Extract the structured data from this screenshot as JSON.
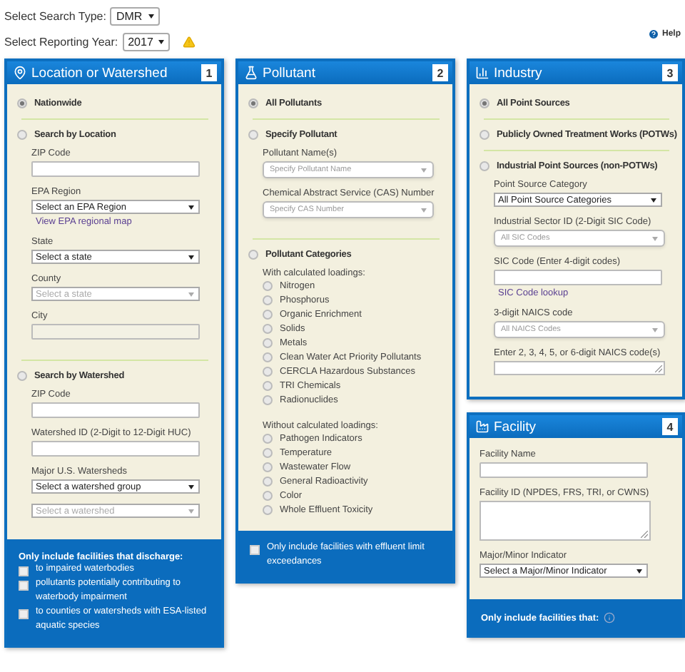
{
  "search_type": {
    "label": "Select Search Type:",
    "value": "DMR"
  },
  "reporting_year": {
    "label": "Select Reporting Year:",
    "value": "2017",
    "warning": true
  },
  "help": "Help",
  "columns": [
    {
      "panels": [
        {
          "number": "1",
          "title": "Location or Watershed",
          "sections": [
            {
              "label": "Nationwide",
              "selected": true
            },
            {
              "label": "Search by Location",
              "selected": false,
              "fields": [
                {
                  "kind": "input",
                  "label": "ZIP Code",
                  "disabled": false
                },
                {
                  "kind": "select",
                  "label": "EPA Region",
                  "value": "Select an EPA Region",
                  "disabled": false
                },
                {
                  "kind": "link",
                  "text": "View EPA regional map"
                },
                {
                  "kind": "select",
                  "label": "State",
                  "value": "Select a state",
                  "disabled": false
                },
                {
                  "kind": "select",
                  "label": "County",
                  "value": "Select a state",
                  "disabled": true
                },
                {
                  "kind": "input",
                  "label": "City",
                  "disabled": true
                }
              ]
            },
            {
              "label": "Search by Watershed",
              "selected": false,
              "fields": [
                {
                  "kind": "input",
                  "label": "ZIP Code",
                  "disabled": false
                },
                {
                  "kind": "input",
                  "label": "Watershed ID (2-Digit to 12-Digit HUC)",
                  "disabled": false
                },
                {
                  "kind": "select",
                  "label": "Major U.S. Watersheds",
                  "value": "Select a watershed group",
                  "disabled": false
                },
                {
                  "kind": "select",
                  "value": "Select a watershed",
                  "disabled": true
                }
              ]
            }
          ],
          "footer": {
            "heading": "Only include facilities that discharge:",
            "checks": [
              {
                "label": "to impaired waterbodies",
                "checked": false
              },
              {
                "label": "pollutants potentially contributing to waterbody impairment",
                "checked": false
              },
              {
                "label": "to counties or watersheds with ESA-listed aquatic species",
                "checked": false
              }
            ]
          }
        }
      ]
    },
    {
      "panels": [
        {
          "number": "2",
          "title": "Pollutant",
          "sections": [
            {
              "label": "All Pollutants",
              "selected": true
            },
            {
              "label": "Specify Pollutant",
              "selected": false,
              "fields": [
                {
                  "kind": "combo",
                  "label": "Pollutant Name(s)",
                  "placeholder": "Specify Pollutant Name"
                },
                {
                  "kind": "combo",
                  "label": "Chemical Abstract Service (CAS) Number",
                  "placeholder": "Specify CAS Number"
                }
              ]
            },
            {
              "label": "Pollutant Categories",
              "selected": false,
              "fields": [
                {
                  "kind": "subheading",
                  "text": "With calculated loadings:"
                },
                {
                  "kind": "option",
                  "label": "Nitrogen",
                  "selected": false
                },
                {
                  "kind": "option",
                  "label": "Phosphorus",
                  "selected": false
                },
                {
                  "kind": "option",
                  "label": "Organic Enrichment",
                  "selected": false
                },
                {
                  "kind": "option",
                  "label": "Solids",
                  "selected": false
                },
                {
                  "kind": "option",
                  "label": "Metals",
                  "selected": false
                },
                {
                  "kind": "option",
                  "label": "Clean Water Act Priority Pollutants",
                  "selected": false
                },
                {
                  "kind": "option",
                  "label": "CERCLA Hazardous Substances",
                  "selected": false
                },
                {
                  "kind": "option",
                  "label": "TRI Chemicals",
                  "selected": false
                },
                {
                  "kind": "option",
                  "label": "Radionuclides",
                  "selected": false
                },
                {
                  "kind": "subheading",
                  "text": "Without calculated loadings:"
                },
                {
                  "kind": "option",
                  "label": "Pathogen Indicators",
                  "selected": false
                },
                {
                  "kind": "option",
                  "label": "Temperature",
                  "selected": false
                },
                {
                  "kind": "option",
                  "label": "Wastewater Flow",
                  "selected": false
                },
                {
                  "kind": "option",
                  "label": "General Radioactivity",
                  "selected": false
                },
                {
                  "kind": "option",
                  "label": "Color",
                  "selected": false
                },
                {
                  "kind": "option",
                  "label": "Whole Effluent Toxicity",
                  "selected": false
                }
              ]
            }
          ],
          "footer": {
            "checks": [
              {
                "label": "Only include facilities with effluent limit exceedances",
                "checked": false
              }
            ]
          }
        }
      ]
    },
    {
      "panels": [
        {
          "number": "3",
          "title": "Industry",
          "sections": [
            {
              "label": "All Point Sources",
              "selected": true
            },
            {
              "label": "Publicly Owned Treatment Works (POTWs)",
              "selected": false
            },
            {
              "label": "Industrial Point Sources (non-POTWs)",
              "selected": false,
              "fields": [
                {
                  "kind": "select",
                  "label": "Point Source Category",
                  "value": "All Point Source Categories",
                  "disabled": false
                },
                {
                  "kind": "combo",
                  "label": "Industrial Sector ID (2-Digit SIC Code)",
                  "placeholder": "All SIC Codes"
                },
                {
                  "kind": "input",
                  "label": "SIC Code (Enter 4-digit codes)",
                  "disabled": false
                },
                {
                  "kind": "link",
                  "text": "SIC Code lookup"
                },
                {
                  "kind": "combo",
                  "label": "3-digit NAICS code",
                  "placeholder": "All NAICS Codes"
                },
                {
                  "kind": "textarea",
                  "label": "Enter 2, 3, 4, 5, or 6-digit NAICS code(s)",
                  "tall": false
                }
              ]
            }
          ]
        },
        {
          "number": "4",
          "title": "Facility",
          "sections": [
            {
              "fields": [
                {
                  "kind": "input",
                  "label": "Facility Name",
                  "disabled": false
                },
                {
                  "kind": "textarea",
                  "label": "Facility ID (NPDES, FRS, TRI, or CWNS)",
                  "tall": true
                },
                {
                  "kind": "select",
                  "label": "Major/Minor Indicator",
                  "value": "Select a Major/Minor Indicator",
                  "disabled": false
                }
              ]
            }
          ],
          "footer": {
            "heading": "Only include facilities that:",
            "info": true
          }
        }
      ]
    }
  ]
}
